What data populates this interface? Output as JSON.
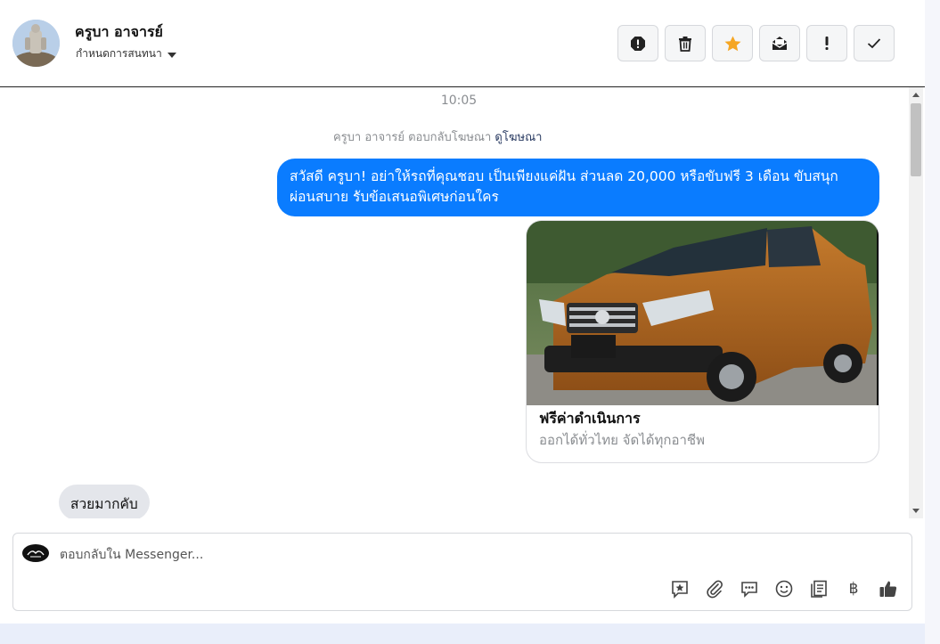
{
  "header": {
    "user_name": "ครูบา อาจารย์",
    "conversation_setting": "กำหนดการสนทนา",
    "actions": [
      {
        "name": "report-spam-button",
        "icon": "exclamation-octagon-icon"
      },
      {
        "name": "delete-button",
        "icon": "trash-icon"
      },
      {
        "name": "star-button",
        "icon": "star-icon",
        "color": "#f5a623"
      },
      {
        "name": "mark-unread-button",
        "icon": "envelope-icon"
      },
      {
        "name": "mark-important-button",
        "icon": "exclamation-icon"
      },
      {
        "name": "mark-done-button",
        "icon": "check-icon"
      }
    ]
  },
  "chat": {
    "time": "10:05",
    "ad_reply_prefix": "ครูบา อาจารย์ ตอบกลับโฆษณา",
    "ad_link": "ดูโฆษณา",
    "outgoing_message": "สวัสดี ครูบา! อย่าให้รถที่คุณชอบ เป็นเพียงแค่ฝัน ส่วนลด 20,000 หรือขับฟรี 3 เดือน ขับสนุก ผ่อนสบาย รับข้อเสนอพิเศษก่อนใคร",
    "card": {
      "title": "ฟรีค่าดำเนินการ",
      "subtitle": "ออกได้ทั่วไทย จัดได้ทุกอาชีพ"
    },
    "incoming_message": "สวยมากคับ"
  },
  "composer": {
    "placeholder": "ตอบกลับใน Messenger...",
    "tools": [
      {
        "name": "saved-reply-icon"
      },
      {
        "name": "attachment-icon"
      },
      {
        "name": "quick-reply-icon"
      },
      {
        "name": "emoji-icon"
      },
      {
        "name": "notes-icon"
      },
      {
        "name": "payment-icon",
        "glyph": "฿"
      },
      {
        "name": "like-icon"
      }
    ]
  },
  "colors": {
    "outgoing_bubble": "#0a7cff",
    "incoming_bubble": "#e4e6eb",
    "star": "#f5a623"
  }
}
